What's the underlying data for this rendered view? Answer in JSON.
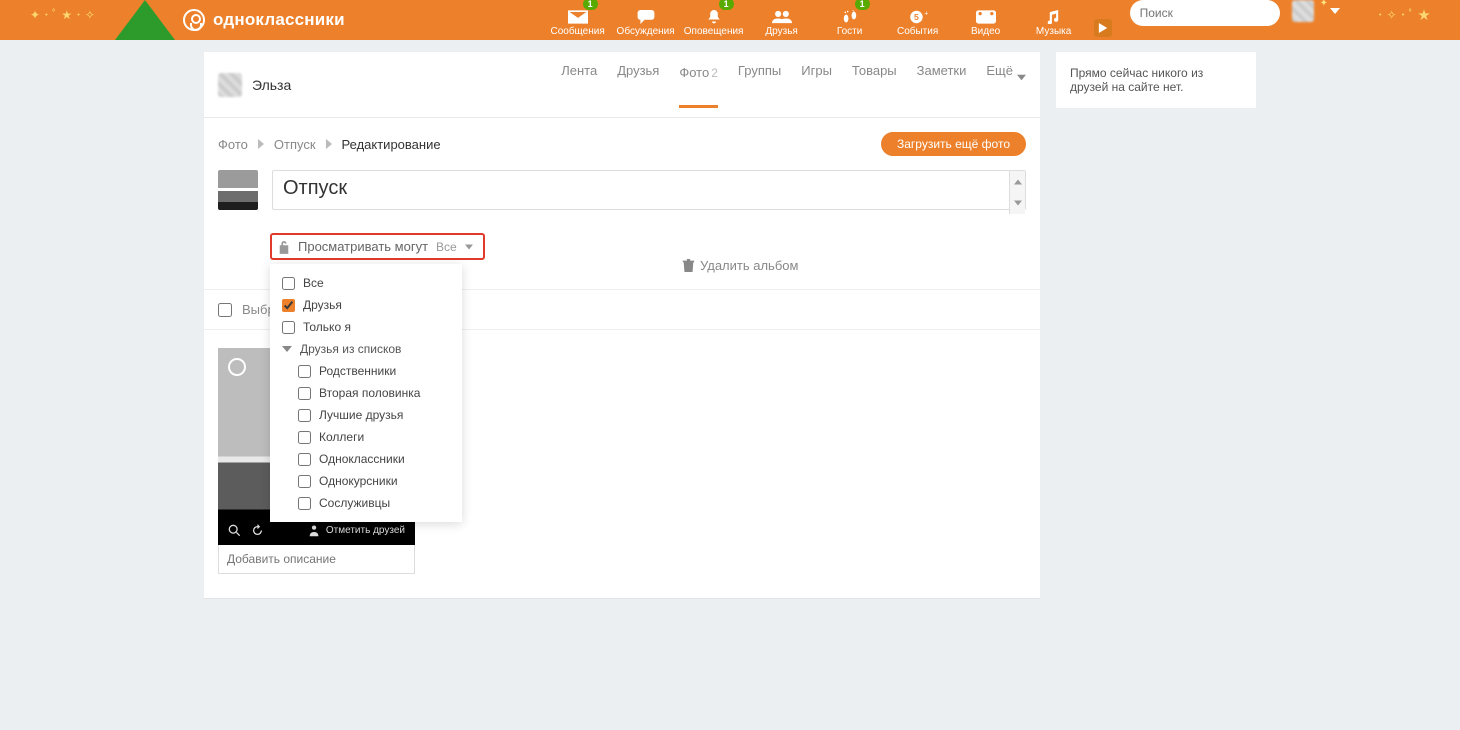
{
  "brand": "одноклассники",
  "topnav": [
    {
      "label": "Сообщения",
      "badge": "1"
    },
    {
      "label": "Обсуждения",
      "badge": null
    },
    {
      "label": "Оповещения",
      "badge": "1"
    },
    {
      "label": "Друзья",
      "badge": null
    },
    {
      "label": "Гости",
      "badge": "1"
    },
    {
      "label": "События",
      "badge": null
    },
    {
      "label": "Видео",
      "badge": null
    },
    {
      "label": "Музыка",
      "badge": null
    }
  ],
  "search": {
    "placeholder": "Поиск"
  },
  "profile": {
    "name": "Эльза"
  },
  "profnav": {
    "items": [
      "Лента",
      "Друзья",
      "Фото",
      "Группы",
      "Игры",
      "Товары",
      "Заметки",
      "Ещё"
    ],
    "active": "Фото",
    "photo_count": "2"
  },
  "breadcrumb": {
    "root": "Фото",
    "album": "Отпуск",
    "current": "Редактирование"
  },
  "buttons": {
    "upload_more": "Загрузить ещё фото"
  },
  "album": {
    "title": "Отпуск"
  },
  "privacy": {
    "label": "Просматривать могут",
    "value": "Все",
    "options": [
      {
        "label": "Все",
        "checked": false
      },
      {
        "label": "Друзья",
        "checked": true
      },
      {
        "label": "Только я",
        "checked": false
      }
    ],
    "lists_label": "Друзья из списков",
    "lists": [
      "Родственники",
      "Вторая половинка",
      "Лучшие друзья",
      "Коллеги",
      "Одноклассники",
      "Однокурсники",
      "Сослуживцы"
    ]
  },
  "actions": {
    "delete_album": "Удалить альбом"
  },
  "select_all": "Выбрать все",
  "photo": {
    "tag_friends": "Отметить друзей",
    "caption_placeholder": "Добавить описание"
  },
  "side": {
    "no_friends_online": "Прямо сейчас никого из друзей на сайте нет."
  }
}
